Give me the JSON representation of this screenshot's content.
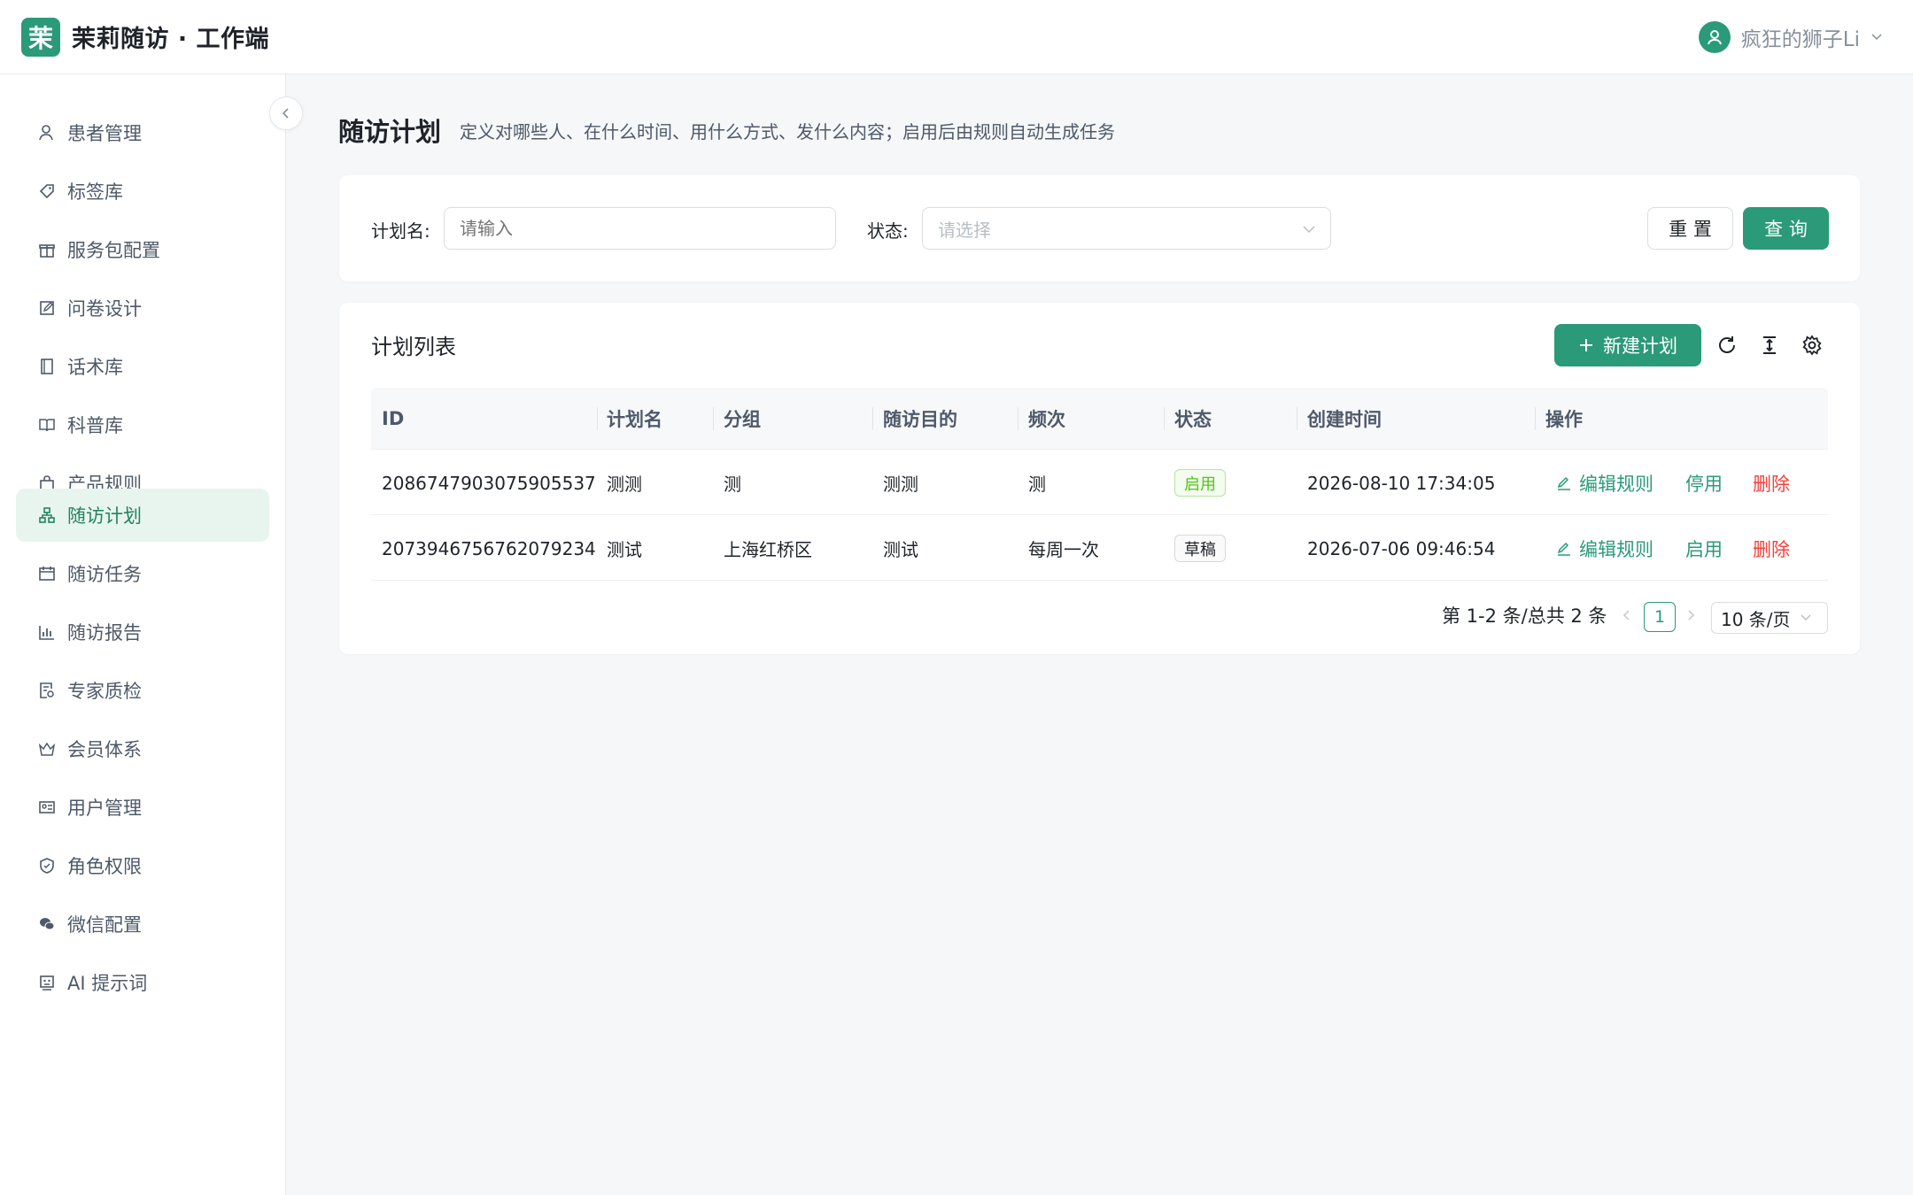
{
  "app": {
    "logo_char": "茉",
    "title": "茉莉随访 · 工作端"
  },
  "user": {
    "name": "疯狂的狮子Li"
  },
  "sidebar": {
    "items": [
      {
        "label": "患者管理",
        "icon": "user-icon"
      },
      {
        "label": "标签库",
        "icon": "tag-icon"
      },
      {
        "label": "服务包配置",
        "icon": "gift-icon"
      },
      {
        "label": "问卷设计",
        "icon": "edit-icon"
      },
      {
        "label": "话术库",
        "icon": "book-icon"
      },
      {
        "label": "科普库",
        "icon": "read-icon"
      },
      {
        "label": "产品规则",
        "icon": "shopping-bag-icon"
      },
      {
        "label": "随访计划",
        "icon": "cluster-icon",
        "active": true
      },
      {
        "label": "随访任务",
        "icon": "calendar-icon"
      },
      {
        "label": "随访报告",
        "icon": "bar-chart-icon"
      },
      {
        "label": "专家质检",
        "icon": "audit-icon"
      },
      {
        "label": "会员体系",
        "icon": "crown-icon"
      },
      {
        "label": "用户管理",
        "icon": "idcard-icon"
      },
      {
        "label": "角色权限",
        "icon": "safety-icon"
      },
      {
        "label": "微信配置",
        "icon": "wechat-icon"
      },
      {
        "label": "AI 提示词",
        "icon": "robot-icon"
      }
    ]
  },
  "page": {
    "title": "随访计划",
    "description": "定义对哪些人、在什么时间、用什么方式、发什么内容；启用后由规则自动生成任务"
  },
  "filter": {
    "name_label": "计划名:",
    "name_placeholder": "请输入",
    "status_label": "状态:",
    "status_placeholder": "请选择",
    "reset_label": "重 置",
    "query_label": "查 询"
  },
  "list": {
    "title": "计划列表",
    "new_label": "新建计划",
    "columns": [
      "ID",
      "计划名",
      "分组",
      "随访目的",
      "频次",
      "状态",
      "创建时间",
      "操作"
    ],
    "rows": [
      {
        "id": "2086747903075905537",
        "name": "测测",
        "group": "测",
        "purpose": "测测",
        "frequency": "测",
        "status": "启用",
        "status_type": "enabled",
        "created": "2026-08-10 17:34:05",
        "action_edit": "编辑规则",
        "action_toggle": "停用",
        "action_delete": "删除"
      },
      {
        "id": "2073946756762079234",
        "name": "测试",
        "group": "上海红桥区",
        "purpose": "测试",
        "frequency": "每周一次",
        "status": "草稿",
        "status_type": "draft",
        "created": "2026-07-06 09:46:54",
        "action_edit": "编辑规则",
        "action_toggle": "启用",
        "action_delete": "删除"
      }
    ]
  },
  "pagination": {
    "total_text": "第 1-2 条/总共 2 条",
    "current_page": "1",
    "page_size": "10 条/页"
  },
  "colors": {
    "brand": "#2b9a78",
    "active_bg": "#e8f5ef",
    "danger": "#f5403d",
    "enabled_tag": "#52c41a"
  }
}
